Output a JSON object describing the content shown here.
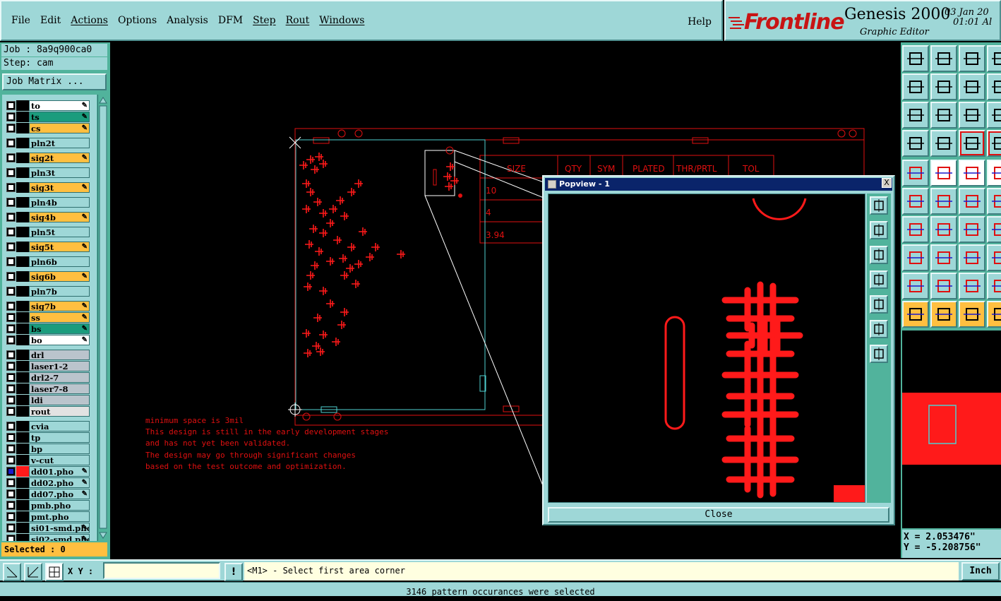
{
  "menubar": {
    "items": [
      "File",
      "Edit",
      "Actions",
      "Options",
      "Analysis",
      "DFM",
      "Step",
      "Rout",
      "Windows"
    ],
    "help": "Help"
  },
  "brand": {
    "logo": "Frontline",
    "title": "Genesis 2000",
    "subtitle": "Graphic Editor",
    "date": "03 Jan 20",
    "time": "01:01 Al"
  },
  "job": {
    "job_label": "Job : 8a9q900ca0",
    "step_label": "Step: cam",
    "matrix_button": "Job Matrix ..."
  },
  "layers": [
    {
      "name": "to",
      "color": "white",
      "edit": true
    },
    {
      "name": "ts",
      "color": "green",
      "edit": true
    },
    {
      "name": "cs",
      "color": "orange",
      "edit": true
    },
    {
      "name": "pln2t",
      "color": "cyan",
      "edit": false
    },
    {
      "name": "sig2t",
      "color": "orange",
      "edit": true
    },
    {
      "name": "pln3t",
      "color": "cyan",
      "edit": false
    },
    {
      "name": "sig3t",
      "color": "orange",
      "edit": true
    },
    {
      "name": "pln4b",
      "color": "cyan",
      "edit": false
    },
    {
      "name": "sig4b",
      "color": "orange",
      "edit": true
    },
    {
      "name": "pln5t",
      "color": "cyan",
      "edit": false
    },
    {
      "name": "sig5t",
      "color": "orange",
      "edit": true
    },
    {
      "name": "pln6b",
      "color": "cyan",
      "edit": false
    },
    {
      "name": "sig6b",
      "color": "orange",
      "edit": true
    },
    {
      "name": "pln7b",
      "color": "cyan",
      "edit": false
    },
    {
      "name": "sig7b",
      "color": "orange",
      "edit": true
    },
    {
      "name": "ss",
      "color": "orange",
      "edit": true
    },
    {
      "name": "bs",
      "color": "green",
      "edit": true
    },
    {
      "name": "bo",
      "color": "white",
      "edit": true
    },
    {
      "name": "drl",
      "color": "gray",
      "edit": false
    },
    {
      "name": "laser1-2",
      "color": "gray",
      "edit": false
    },
    {
      "name": "drl2-7",
      "color": "gray",
      "edit": false
    },
    {
      "name": "laser7-8",
      "color": "gray",
      "edit": false
    },
    {
      "name": "ldi",
      "color": "gray",
      "edit": false
    },
    {
      "name": "rout",
      "color": "light",
      "edit": false
    },
    {
      "name": "cvia",
      "color": "cyan",
      "edit": false
    },
    {
      "name": "tp",
      "color": "cyan",
      "edit": false
    },
    {
      "name": "bp",
      "color": "cyan",
      "edit": false
    },
    {
      "name": "v-cut",
      "color": "cyan",
      "edit": false
    },
    {
      "name": "dd01.pho",
      "color": "cyan",
      "edit": true,
      "active": true
    },
    {
      "name": "dd02.pho",
      "color": "cyan",
      "edit": true
    },
    {
      "name": "dd07.pho",
      "color": "cyan",
      "edit": true
    },
    {
      "name": "pmb.pho",
      "color": "cyan",
      "edit": false
    },
    {
      "name": "pmt.pho",
      "color": "cyan",
      "edit": false
    },
    {
      "name": "si01-smd.pho",
      "color": "cyan",
      "edit": true
    },
    {
      "name": "si02-smd.pho",
      "color": "cyan",
      "edit": true
    }
  ],
  "selected": "Selected : 0",
  "drill_table": {
    "headers": [
      "SIZE",
      "QTY",
      "SYM",
      "PLATED",
      "THR/PRTL",
      "TOL"
    ],
    "cells": [
      "10",
      "4",
      "3.94"
    ]
  },
  "notes": [
    "minimum space is 3mil",
    " This design is still in the early development stages",
    "and has not yet been validated.",
    "The design may go through significant changes",
    "based on the test outcome and optimization."
  ],
  "popup": {
    "title": "Popview - 1",
    "close_label": "Close",
    "close_x": "X"
  },
  "coords": {
    "x": "X = 2.053476\"",
    "y": "Y = -5.208756\""
  },
  "bottom": {
    "xy_label": "X Y :",
    "xy_value": "",
    "message": "<M1> - Select first area corner",
    "units": "Inch",
    "alert": "!"
  },
  "status": "3146 pattern occurances were selected",
  "colors": {
    "accent": "#9ed7d7",
    "panel": "#51b39c",
    "board": "#e01010",
    "profile": "#4fd0d0"
  }
}
